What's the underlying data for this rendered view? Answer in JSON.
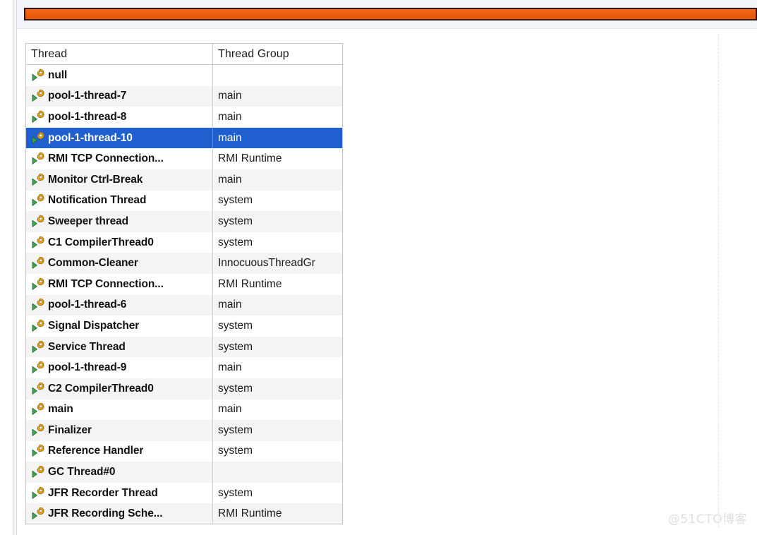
{
  "window": {
    "progress_bar": {
      "name": "orange-progress-bar",
      "fill_color": "#ec5f10",
      "border_color": "#241008",
      "panel_background": "#f2f6fb"
    },
    "background": "#ffffff"
  },
  "table": {
    "columns": [
      {
        "key": "thread",
        "label": "Thread"
      },
      {
        "key": "group",
        "label": "Thread Group"
      }
    ],
    "selected_index": 3,
    "selection_color": "#1f5fd0",
    "stripe_color": "#f4f4f4",
    "row_icon": "thread-running-icon",
    "rows": [
      {
        "thread": "null",
        "group": ""
      },
      {
        "thread": "pool-1-thread-7",
        "group": "main"
      },
      {
        "thread": "pool-1-thread-8",
        "group": "main"
      },
      {
        "thread": "pool-1-thread-10",
        "group": "main"
      },
      {
        "thread": "RMI TCP Connection...",
        "group": "RMI Runtime"
      },
      {
        "thread": "Monitor Ctrl-Break",
        "group": "main"
      },
      {
        "thread": "Notification Thread",
        "group": "system"
      },
      {
        "thread": "Sweeper thread",
        "group": "system"
      },
      {
        "thread": "C1 CompilerThread0",
        "group": "system"
      },
      {
        "thread": "Common-Cleaner",
        "group": "InnocuousThreadGr"
      },
      {
        "thread": "RMI TCP Connection...",
        "group": "RMI Runtime"
      },
      {
        "thread": "pool-1-thread-6",
        "group": "main"
      },
      {
        "thread": "Signal Dispatcher",
        "group": "system"
      },
      {
        "thread": "Service Thread",
        "group": "system"
      },
      {
        "thread": "pool-1-thread-9",
        "group": "main"
      },
      {
        "thread": "C2 CompilerThread0",
        "group": "system"
      },
      {
        "thread": "main",
        "group": "main"
      },
      {
        "thread": "Finalizer",
        "group": "system"
      },
      {
        "thread": "Reference Handler",
        "group": "system"
      },
      {
        "thread": "GC Thread#0",
        "group": ""
      },
      {
        "thread": "JFR Recorder Thread",
        "group": "system"
      },
      {
        "thread": "JFR Recording Sche...",
        "group": "RMI Runtime"
      }
    ]
  },
  "watermark": {
    "text": "@51CTO博客"
  }
}
